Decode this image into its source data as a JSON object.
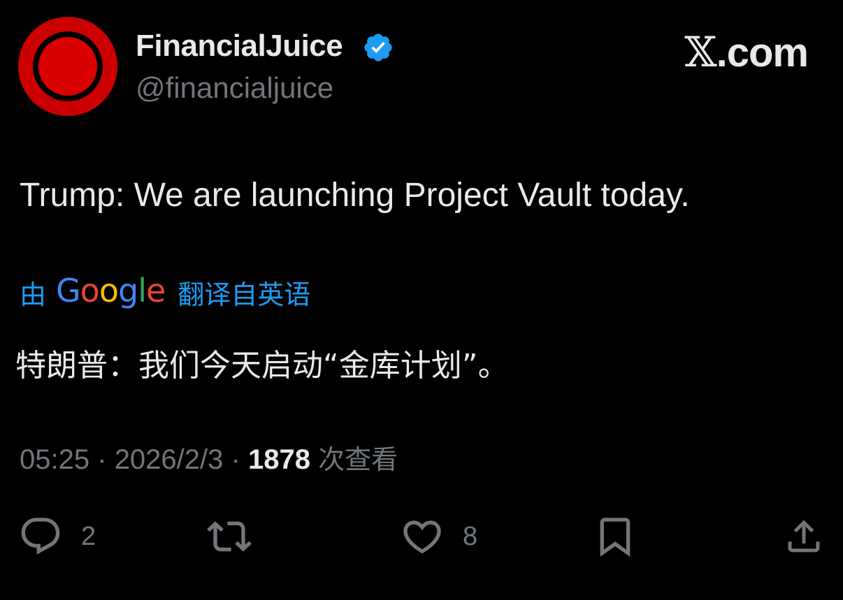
{
  "author": {
    "display_name": "FinancialJuice",
    "handle": "@financialjuice",
    "verified": true,
    "avatar_colors": {
      "outer": "#cc0000",
      "ring": "#000000",
      "inner": "#d90000"
    }
  },
  "brand": {
    "x_mark": "𝕏",
    "domain": ".com"
  },
  "tweet": {
    "text": "Trump: We are launching Project Vault today."
  },
  "translation": {
    "by_label": "由",
    "provider": [
      "G",
      "o",
      "o",
      "g",
      "l",
      "e"
    ],
    "provider_colors": [
      "#4285f4",
      "#ea4335",
      "#fbbc05",
      "#4285f4",
      "#34a853",
      "#ea4335"
    ],
    "from_label": "翻译自英语",
    "text": "特朗普：我们今天启动“金库计划”。"
  },
  "meta": {
    "time": "05:25",
    "separator": "·",
    "date": "2026/2/3",
    "views_count": "1878",
    "views_label": "次查看"
  },
  "actions": {
    "reply": {
      "icon": "reply-icon",
      "count": "2"
    },
    "retweet": {
      "icon": "retweet-icon",
      "count": ""
    },
    "like": {
      "icon": "heart-icon",
      "count": "8"
    },
    "bookmark": {
      "icon": "bookmark-icon"
    },
    "share": {
      "icon": "share-icon"
    }
  },
  "colors": {
    "background": "#000000",
    "primary_text": "#e7e9ea",
    "secondary_text": "#71767b",
    "accent_blue": "#1d9bf0"
  }
}
